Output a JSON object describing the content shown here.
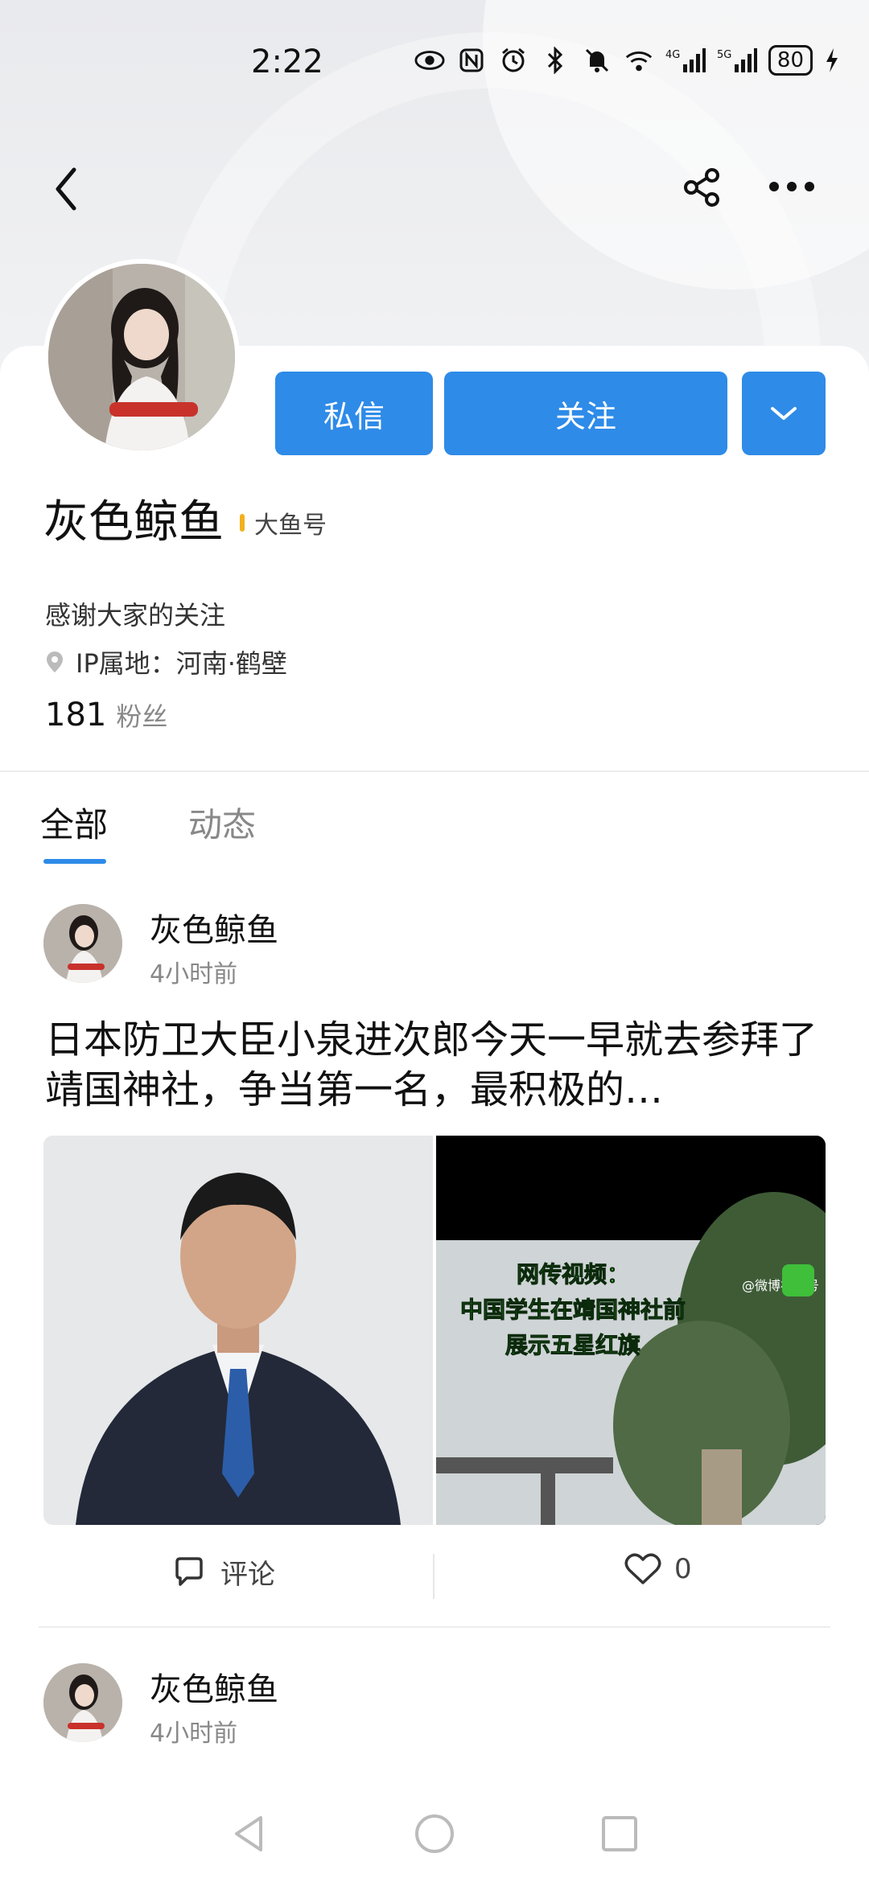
{
  "status_bar": {
    "time": "2:22",
    "network_5g": "5G",
    "network_4g": "4G",
    "wifi_label": "6",
    "battery": "80",
    "icons": [
      "eye-icon",
      "nfc-icon",
      "alarm-icon",
      "bluetooth-icon",
      "mute-icon",
      "wifi-icon",
      "signal-icon",
      "battery-icon",
      "charging-icon"
    ]
  },
  "nav": {
    "icons": [
      "back-icon",
      "share-icon",
      "more-icon"
    ]
  },
  "profile": {
    "name": "灰色鲸鱼",
    "badge": "大鱼号",
    "intro": "感谢大家的关注",
    "ip_location": "IP属地：河南·鹤壁",
    "fans_count": "181",
    "fans_label": "粉丝",
    "buttons": {
      "message": "私信",
      "follow": "关注"
    }
  },
  "tabs": [
    {
      "label": "全部",
      "active": true
    },
    {
      "label": "动态",
      "active": false
    }
  ],
  "posts": [
    {
      "author": "灰色鲸鱼",
      "time": "4小时前",
      "text": "日本防卫大臣小泉进次郎今天一早就去参拜了靖国神社，争当第一名，最积极的…",
      "image_caption_lines": [
        "网传视频：",
        "中国学生在靖国神社前",
        "展示五星红旗"
      ],
      "watermark": "@微博视频号",
      "comment_label": "评论",
      "like_count": "0"
    },
    {
      "author": "灰色鲸鱼",
      "time": "4小时前"
    }
  ],
  "colors": {
    "accent": "#2e8be8",
    "badge_bar": "#f2b01e",
    "caption_green": "#3fbf3a"
  }
}
